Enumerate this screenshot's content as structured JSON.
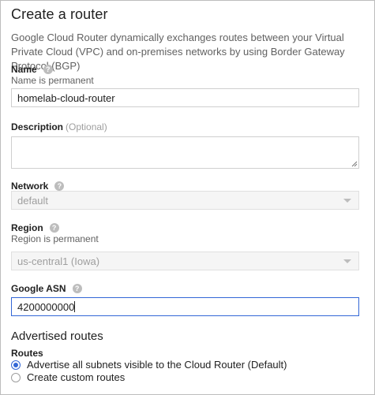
{
  "page": {
    "title": "Create a router",
    "intro": "Google Cloud Router dynamically exchanges routes between your Virtual Private Cloud (VPC) and on-premises networks by using Border Gateway Protocol (BGP)"
  },
  "fields": {
    "name": {
      "label": "Name",
      "help": "?",
      "note": "Name is permanent",
      "value": "homelab-cloud-router"
    },
    "description": {
      "label": "Description",
      "optional": "(Optional)",
      "value": ""
    },
    "network": {
      "label": "Network",
      "help": "?",
      "value": "default"
    },
    "region": {
      "label": "Region",
      "help": "?",
      "note": "Region is permanent",
      "value": "us-central1 (Iowa)"
    },
    "asn": {
      "label": "Google ASN",
      "help": "?",
      "value": "4200000000"
    }
  },
  "advertised_routes": {
    "title": "Advertised routes",
    "routes_label": "Routes",
    "options": [
      {
        "label": "Advertise all subnets visible to the Cloud Router (Default)",
        "checked": true
      },
      {
        "label": "Create custom routes",
        "checked": false
      }
    ]
  },
  "colors": {
    "accent": "#3367d6",
    "text": "#212121",
    "muted": "#616161",
    "disabled_bg": "#f5f5f5"
  }
}
